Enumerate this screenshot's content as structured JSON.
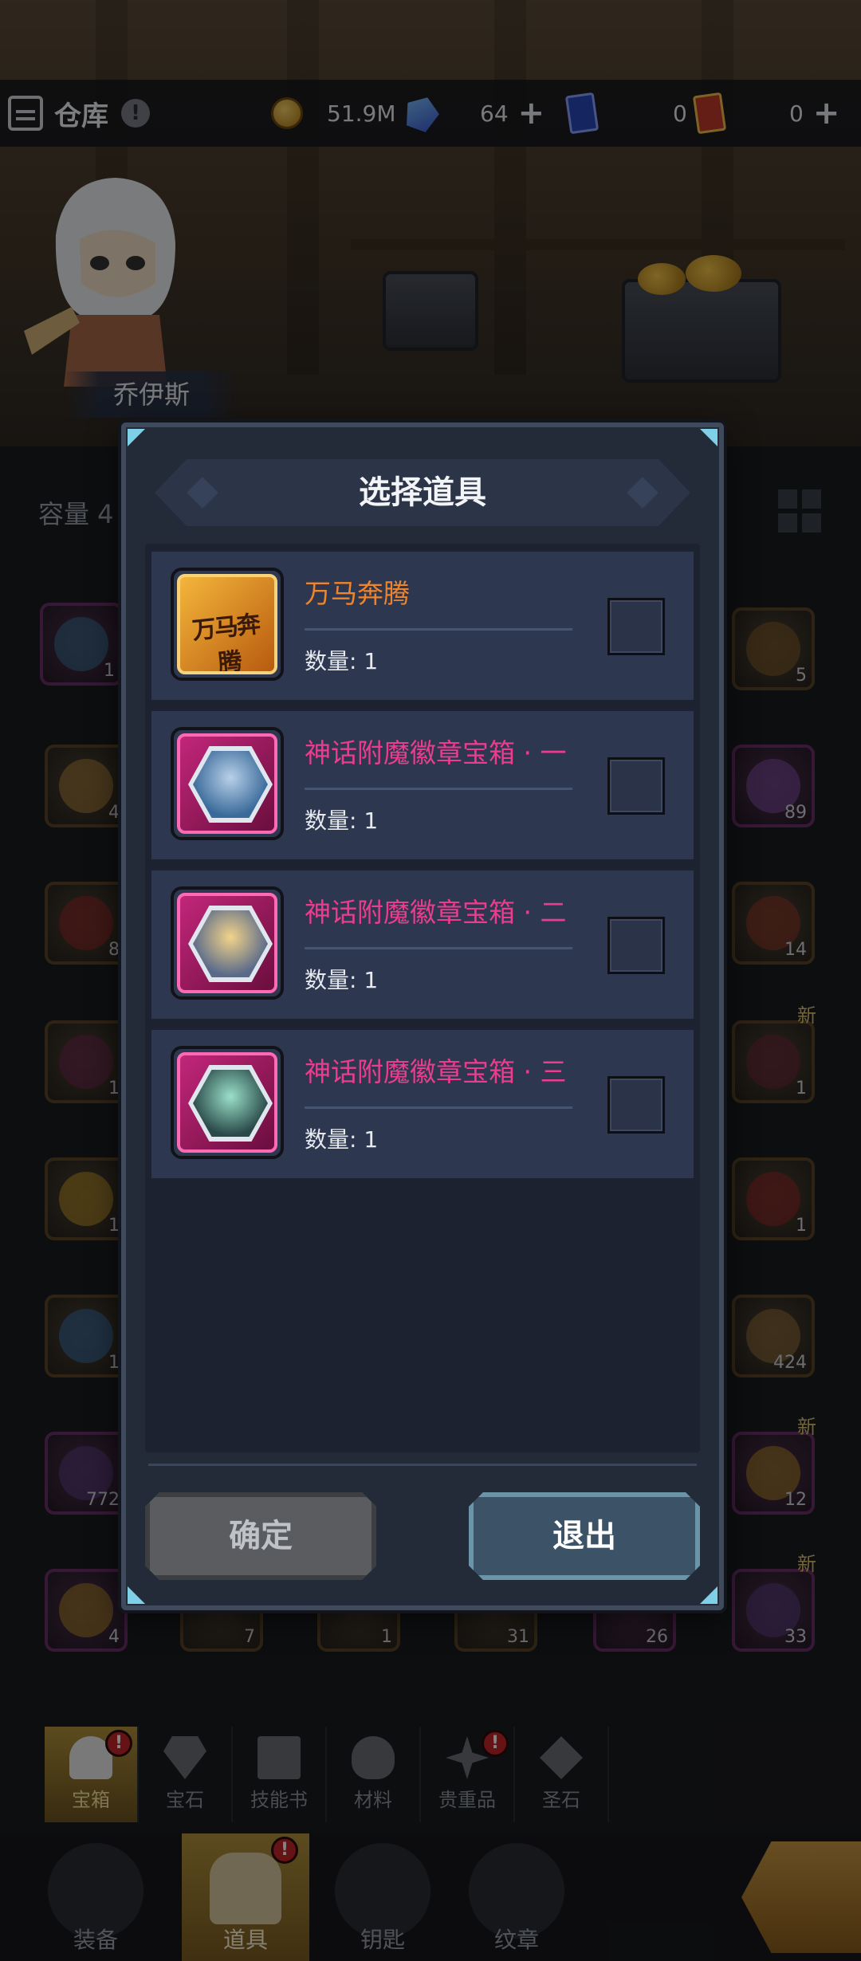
{
  "topbar": {
    "warehouse_label": "仓库",
    "info_glyph": "!",
    "gold": "51.9M",
    "gems": "64",
    "blue_tickets": "0",
    "red_tickets": "0",
    "plus": "+",
    "icons": [
      "warehouse-icon",
      "info-icon",
      "gold-coin-icon",
      "gem-icon",
      "blue-ticket-icon",
      "red-ticket-icon"
    ]
  },
  "scene": {
    "hero_name": "乔伊斯"
  },
  "inventory": {
    "capacity_label": "容量 4",
    "left_counts": [
      "1",
      "4",
      "8",
      "1",
      "1",
      "1",
      "772",
      "4"
    ],
    "right_counts": [
      "5",
      "89",
      "14",
      "1",
      "1",
      "424",
      "12",
      "33"
    ],
    "bottom_counts": [
      "7",
      "1",
      "31",
      "26"
    ],
    "new_tag": "新"
  },
  "dialog": {
    "title": "选择道具",
    "items": [
      {
        "name": "万马奔腾",
        "qty": "数量: 1",
        "icon_text": "万马奔腾",
        "rarity": "orange",
        "checked": false
      },
      {
        "name": "神话附魔徽章宝箱 · 一",
        "qty": "数量: 1",
        "rarity": "pink",
        "checked": false
      },
      {
        "name": "神话附魔徽章宝箱 · 二",
        "qty": "数量: 1",
        "rarity": "pink",
        "checked": false
      },
      {
        "name": "神话附魔徽章宝箱 · 三",
        "qty": "数量: 1",
        "rarity": "pink",
        "checked": false
      }
    ],
    "confirm_label": "确定",
    "exit_label": "退出"
  },
  "categories": [
    {
      "label": "宝箱",
      "badge": "!",
      "active": true
    },
    {
      "label": "宝石"
    },
    {
      "label": "技能书"
    },
    {
      "label": "材料"
    },
    {
      "label": "贵重品",
      "badge": "!"
    },
    {
      "label": "圣石"
    }
  ],
  "bottom_nav": [
    {
      "label": "装备"
    },
    {
      "label": "道具",
      "badge": "!",
      "active": true
    },
    {
      "label": "钥匙"
    },
    {
      "label": "纹章"
    }
  ],
  "colors": {
    "orange_rarity": "#f0842a",
    "pink_rarity": "#ec3c8e",
    "active_tab": "#b0903a"
  }
}
